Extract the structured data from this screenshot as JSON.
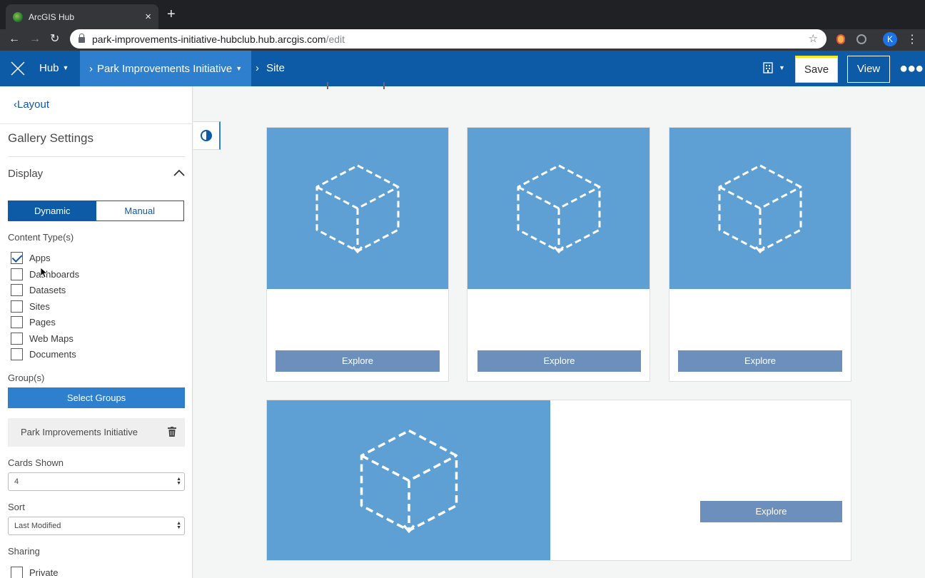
{
  "browser": {
    "tab_title": "ArcGIS Hub",
    "tab_close": "×",
    "new_tab": "+",
    "url_host": "park-improvements-initiative-hubclub.hub.arcgis.com",
    "url_path": "/edit",
    "profile_initial": "K"
  },
  "header": {
    "hub_label": "Hub",
    "site_label": "Park Improvements Initiative",
    "page_label": "Site",
    "save_label": "Save",
    "view_label": "View",
    "brand_color": "#0d5aa7"
  },
  "sidebar": {
    "back_label": "Layout",
    "panel_title": "Gallery Settings",
    "section_title": "Display",
    "mode_tabs": [
      "Dynamic",
      "Manual"
    ],
    "content_types_label": "Content Type(s)",
    "content_types": [
      {
        "label": "Apps",
        "checked": true
      },
      {
        "label": "Dashboards",
        "checked": false
      },
      {
        "label": "Datasets",
        "checked": false
      },
      {
        "label": "Sites",
        "checked": false
      },
      {
        "label": "Pages",
        "checked": false
      },
      {
        "label": "Web Maps",
        "checked": false
      },
      {
        "label": "Documents",
        "checked": false
      }
    ],
    "groups_label": "Group(s)",
    "select_groups_label": "Select Groups",
    "selected_group": "Park Improvements Initiative",
    "cards_shown_label": "Cards Shown",
    "cards_shown_value": "4",
    "sort_label": "Sort",
    "sort_value": "Last Modified",
    "sharing_label": "Sharing",
    "sharing_option": "Private"
  },
  "gallery": {
    "cards": [
      {
        "button": "Explore"
      },
      {
        "button": "Explore"
      },
      {
        "button": "Explore"
      },
      {
        "button": "Explore"
      }
    ],
    "thumb_color": "#5fa0d4",
    "button_color": "#6d8fbb"
  }
}
